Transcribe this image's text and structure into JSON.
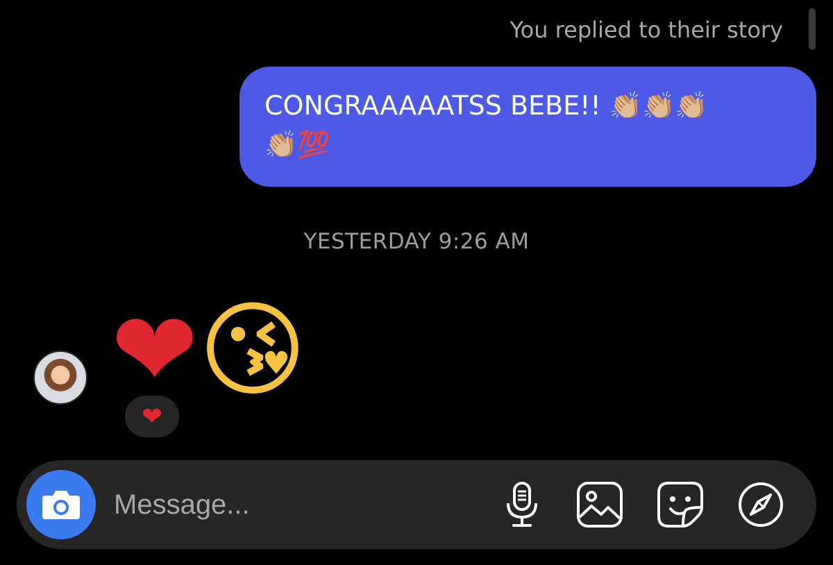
{
  "thread": {
    "reply_note": "You replied to their story",
    "sent_message": {
      "text": "CONGRAAAAATSS BEBE!! 👏🏼👏🏼👏🏼\n👏🏼💯"
    },
    "timestamp": "YESTERDAY 9:26 AM",
    "received_message": {
      "emoji_heart": "❤",
      "emoji_kiss": "😘"
    },
    "reaction": "❤",
    "avatar_icon": "user-avatar"
  },
  "composer": {
    "placeholder": "Message...",
    "value": "",
    "icons": [
      "camera-icon",
      "microphone-icon",
      "gallery-icon",
      "sticker-icon",
      "compass-icon"
    ]
  },
  "colors": {
    "sent_bubble": "#4d5ae5",
    "camera_button": "#3a7bf0",
    "composer_bg": "#262626",
    "background": "#000000"
  }
}
